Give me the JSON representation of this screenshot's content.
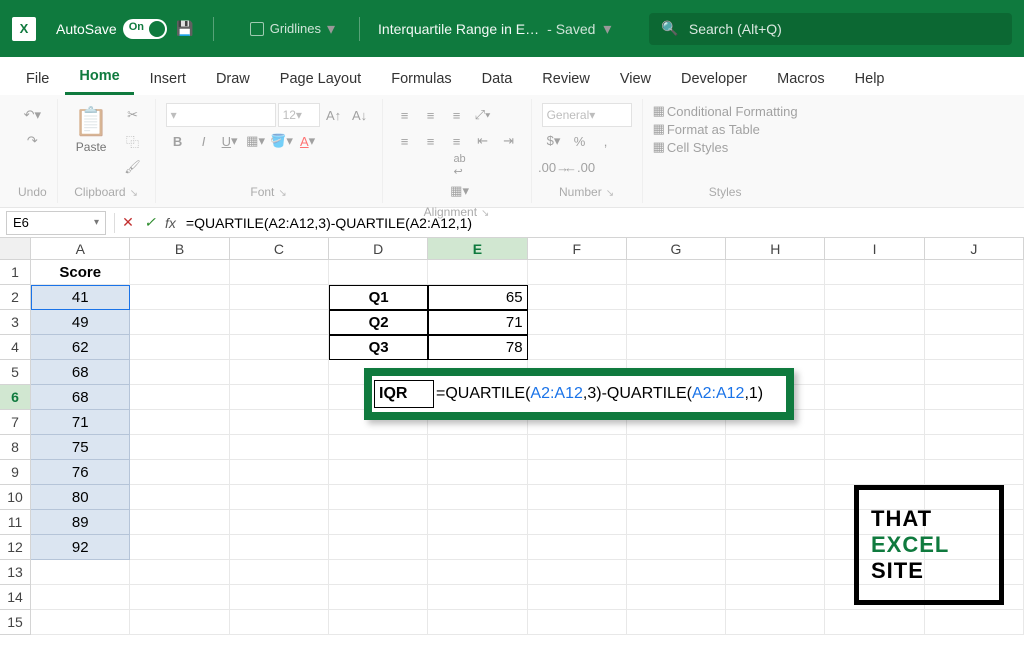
{
  "titlebar": {
    "autosave_label": "AutoSave",
    "toggle_on": "On",
    "gridlines_label": "Gridlines",
    "doc_title": "Interquartile Range in E…",
    "saved": "- Saved",
    "search_placeholder": "Search (Alt+Q)"
  },
  "tabs": [
    "File",
    "Home",
    "Insert",
    "Draw",
    "Page Layout",
    "Formulas",
    "Data",
    "Review",
    "View",
    "Developer",
    "Macros",
    "Help"
  ],
  "ribbon": {
    "undo": "Undo",
    "clipboard": "Clipboard",
    "paste": "Paste",
    "font": "Font",
    "font_size": "12",
    "alignment": "Alignment",
    "number": "Number",
    "number_format": "General",
    "styles": "Styles",
    "cond_fmt": "Conditional Formatting",
    "table_fmt": "Format as Table",
    "cell_styles": "Cell Styles"
  },
  "formula_bar": {
    "name_box": "E6",
    "formula": "=QUARTILE(A2:A12,3)-QUARTILE(A2:A12,1)"
  },
  "columns": [
    "A",
    "B",
    "C",
    "D",
    "E",
    "F",
    "G",
    "H",
    "I",
    "J"
  ],
  "sheet": {
    "header": "Score",
    "scores": [
      "41",
      "49",
      "62",
      "68",
      "68",
      "71",
      "75",
      "76",
      "80",
      "89",
      "92"
    ],
    "qtable": [
      {
        "label": "Q1",
        "value": "65"
      },
      {
        "label": "Q2",
        "value": "71"
      },
      {
        "label": "Q3",
        "value": "78"
      }
    ],
    "iqr_label": "IQR",
    "iqr_formula_pre": "=QUARTILE(",
    "iqr_range": "A2:A12",
    "iqr_mid": ",3)-QUARTILE(",
    "iqr_end": ",1)"
  },
  "watermark": {
    "l1": "THAT",
    "l2": "EXCEL",
    "l3": "SITE"
  }
}
